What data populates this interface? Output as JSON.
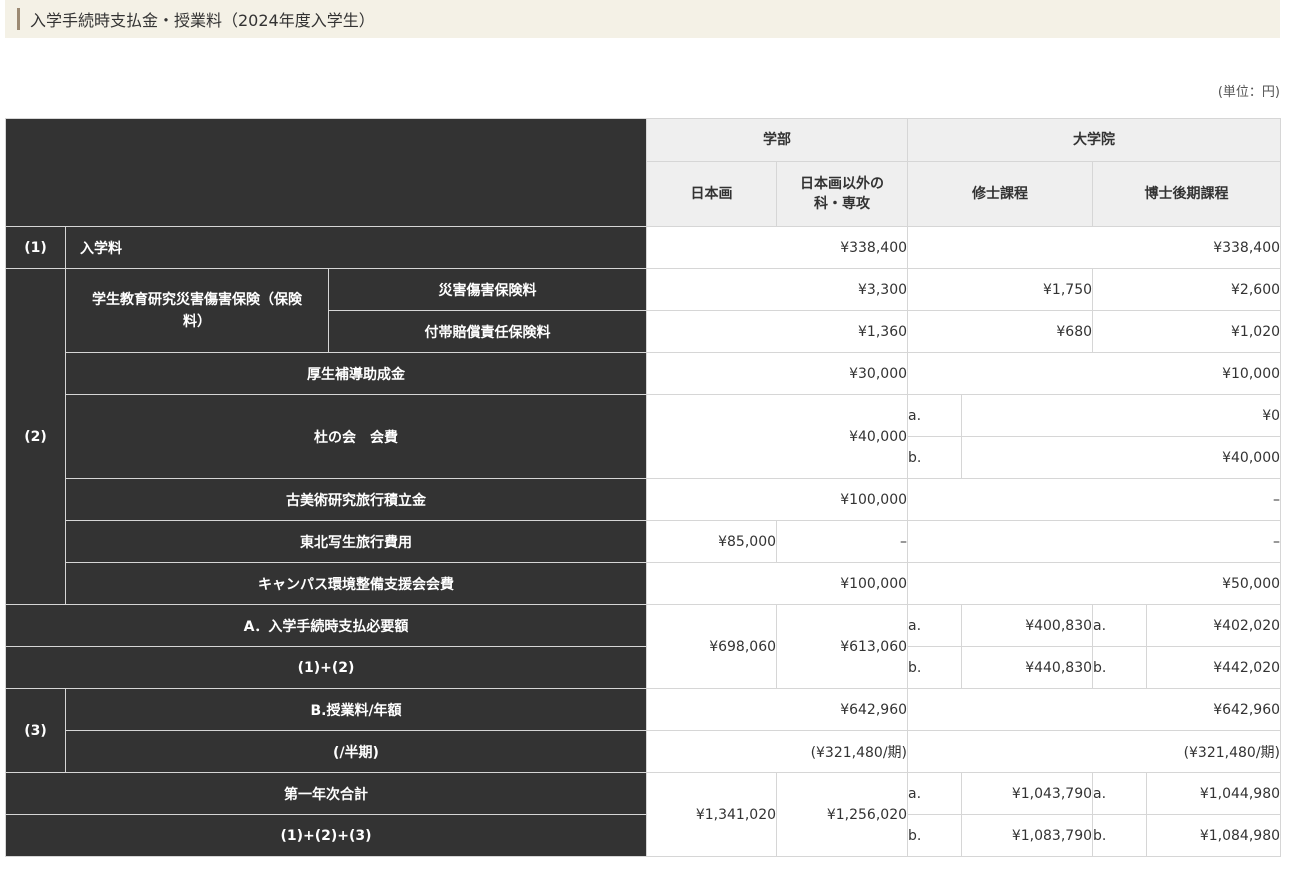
{
  "title": "入学手続時支払金・授業料（2024年度入学生）",
  "unit": "(単位：円)",
  "header": {
    "gakubu": "学部",
    "daigakuin": "大学院",
    "nihonga": "日本画",
    "nihonga_igai": "日本画以外の\n科・専攻",
    "shushi": "修士課程",
    "hakushi": "博士後期課程"
  },
  "rows": {
    "r1_num": "(1)",
    "r1_label": "入学料",
    "r1_gakubu": "¥338,400",
    "r1_daigakuin": "¥338,400",
    "r2_num": "(2)",
    "hoken_label": "学生教育研究災害傷害保険（保険料）",
    "saigai_label": "災害傷害保険料",
    "saigai_gakubu": "¥3,300",
    "saigai_shushi": "¥1,750",
    "saigai_hakushi": "¥2,600",
    "baisho_label": "付帯賠償責任保険料",
    "baisho_gakubu": "¥1,360",
    "baisho_shushi": "¥680",
    "baisho_hakushi": "¥1,020",
    "kosei_label": "厚生補導助成金",
    "kosei_gakubu": "¥30,000",
    "kosei_daigakuin": "¥10,000",
    "mori_label": "杜の会　会費",
    "mori_gakubu": "¥40,000",
    "mori_a": "a.",
    "mori_a_val": "¥0",
    "mori_b": "b.",
    "mori_b_val": "¥40,000",
    "kobijutsu_label": "古美術研究旅行積立金",
    "kobijutsu_gakubu": "¥100,000",
    "kobijutsu_daigakuin": "–",
    "tohoku_label": "東北写生旅行費用",
    "tohoku_nihonga": "¥85,000",
    "tohoku_igai": "–",
    "tohoku_daigakuin": "–",
    "campus_label": "キャンパス環境整備支援会会費",
    "campus_gakubu": "¥100,000",
    "campus_daigakuin": "¥50,000",
    "a_label": "A．入学手続時支払必要額",
    "a_sub": "(1)+(2)",
    "a_nihonga": "¥698,060",
    "a_igai": "¥613,060",
    "a_shushi_a": "¥400,830",
    "a_shushi_b": "¥440,830",
    "a_hakushi_a": "¥402,020",
    "a_hakushi_b": "¥442,020",
    "r3_num": "(3)",
    "b_label": "B.授業料/年額",
    "b_gakubu": "¥642,960",
    "b_daigakuin": "¥642,960",
    "half_label": "(/半期)",
    "half_gakubu": "(¥321,480/期)",
    "half_daigakuin": "(¥321,480/期)",
    "total_label": "第一年次合計",
    "total_sub": "(1)+(2)+(3)",
    "total_nihonga": "¥1,341,020",
    "total_igai": "¥1,256,020",
    "total_shushi_a": "¥1,043,790",
    "total_shushi_b": "¥1,083,790",
    "total_hakushi_a": "¥1,044,980",
    "total_hakushi_b": "¥1,084,980",
    "a_mark": "a.",
    "b_mark": "b."
  }
}
